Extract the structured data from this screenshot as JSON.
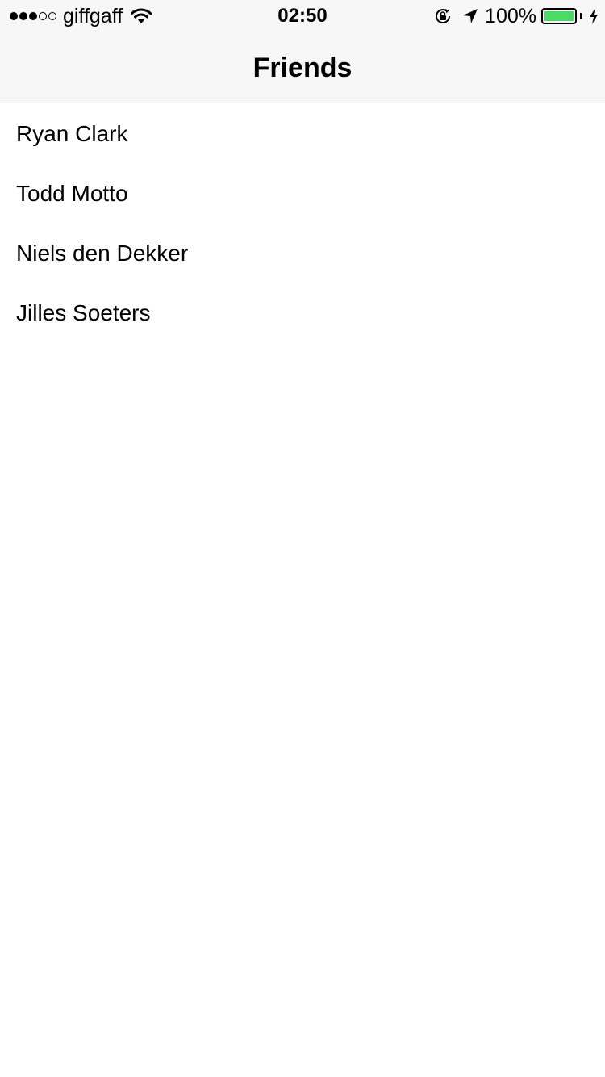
{
  "status_bar": {
    "signal_total": 5,
    "signal_filled": 3,
    "carrier": "giffgaff",
    "time": "02:50",
    "battery_percent": "100%",
    "battery_level": 1.0,
    "battery_color": "#4cd964",
    "icons": [
      "wifi-icon",
      "rotation-lock-icon",
      "location-arrow-icon",
      "battery-icon",
      "charging-bolt-icon"
    ]
  },
  "nav": {
    "title": "Friends"
  },
  "friends": [
    {
      "name": "Ryan Clark"
    },
    {
      "name": "Todd Motto"
    },
    {
      "name": "Niels den Dekker"
    },
    {
      "name": "Jilles Soeters"
    }
  ]
}
